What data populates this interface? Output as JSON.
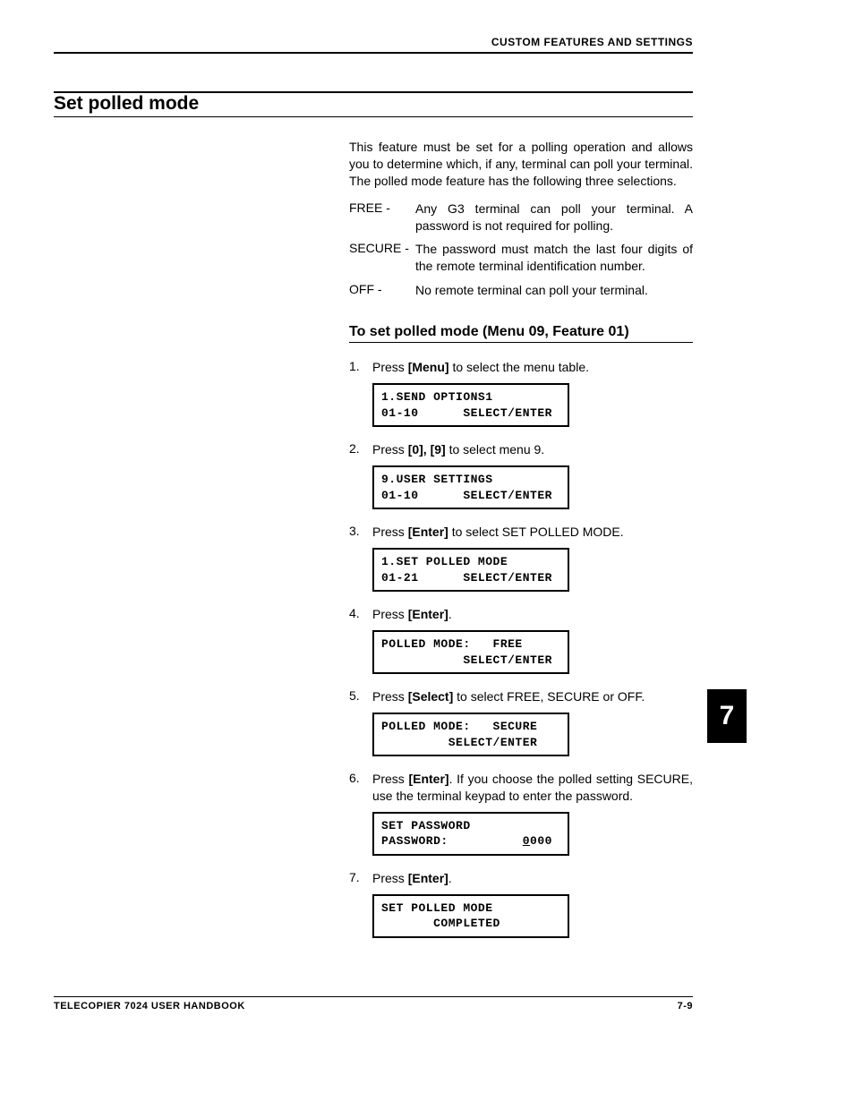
{
  "header": {
    "right": "CUSTOM FEATURES AND SETTINGS"
  },
  "section_title": "Set polled mode",
  "intro": "This feature must be set for a polling operation and allows you to determine which, if any, terminal can poll your terminal. The polled mode feature has the following three selections.",
  "defs": [
    {
      "term": "FREE -",
      "desc": "Any G3 terminal can poll your terminal.  A password is not required for polling."
    },
    {
      "term": "SECURE -",
      "desc": "The password must match the last four digits of the remote terminal identification number."
    },
    {
      "term": "OFF -",
      "desc": "No remote terminal can poll your terminal."
    }
  ],
  "subhead": "To set polled mode (Menu 09, Feature 01)",
  "steps": [
    {
      "num": "1.",
      "pre": "Press ",
      "key": "[Menu]",
      "post": " to select the menu table.",
      "lcd": "1.SEND OPTIONS1\n01-10      SELECT/ENTER"
    },
    {
      "num": "2.",
      "pre": "Press ",
      "key": "[0], [9]",
      "post": " to select menu 9.",
      "lcd": "9.USER SETTINGS\n01-10      SELECT/ENTER"
    },
    {
      "num": "3.",
      "pre": "Press ",
      "key": "[Enter]",
      "post": " to select SET POLLED MODE.",
      "lcd": "1.SET POLLED MODE\n01-21      SELECT/ENTER"
    },
    {
      "num": "4.",
      "pre": "Press ",
      "key": "[Enter]",
      "post": ".",
      "lcd": "POLLED MODE:   FREE\n           SELECT/ENTER"
    },
    {
      "num": "5.",
      "pre": "Press ",
      "key": "[Select]",
      "post": " to select FREE, SECURE or OFF.",
      "lcd": "POLLED MODE:   SECURE\n         SELECT/ENTER"
    },
    {
      "num": "6.",
      "pre": "Press ",
      "key": "[Enter]",
      "post": ".  If you choose the polled setting SECURE, use the terminal keypad to enter the password.",
      "lcd_html": "SET PASSWORD\nPASSWORD:          <span class=\"underline\">0</span>000"
    },
    {
      "num": "7.",
      "pre": "Press ",
      "key": "[Enter]",
      "post": ".",
      "lcd": "SET POLLED MODE\n       COMPLETED"
    }
  ],
  "tab": "7",
  "footer": {
    "left": "TELECOPIER 7024 USER HANDBOOK",
    "right": "7-9"
  }
}
